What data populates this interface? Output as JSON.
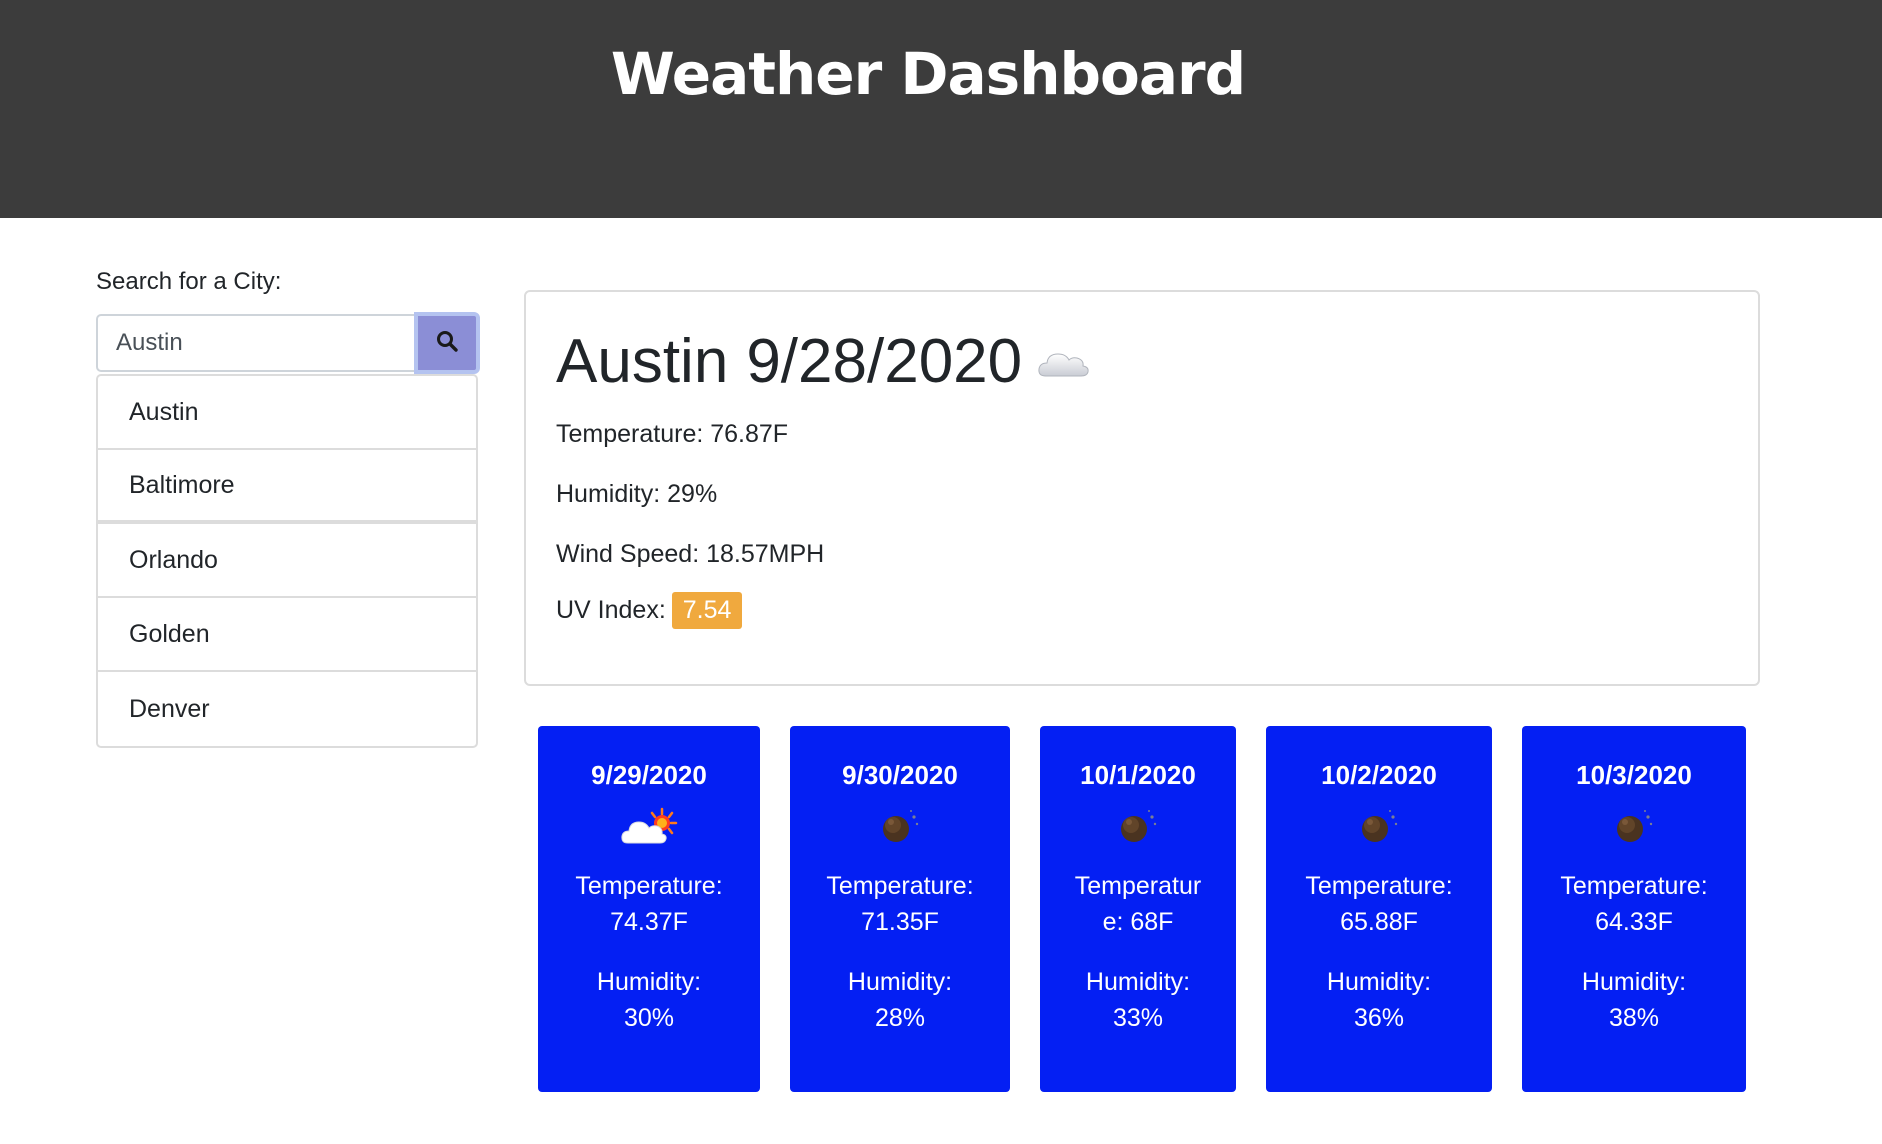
{
  "header": {
    "title": "Weather Dashboard"
  },
  "search": {
    "label": "Search for a City:",
    "value": "Austin",
    "button_icon": "search-icon"
  },
  "history": [
    "Austin",
    "Baltimore",
    "Orlando",
    "Golden",
    "Denver"
  ],
  "current": {
    "city": "Austin",
    "date": "9/28/2020",
    "icon": "cloud-icon",
    "temperature": "Temperature: 76.87F",
    "humidity": "Humidity: 29%",
    "wind": "Wind Speed: 18.57MPH",
    "uv_label": "UV Index:",
    "uv_value": "7.54",
    "uv_color": "#f0a93e"
  },
  "forecast": [
    {
      "date": "9/29/2020",
      "icon": "partly-cloudy-sun-icon",
      "temp_label": "Temperature:",
      "temp": "74.37F",
      "hum_label": "Humidity:",
      "hum": "30%"
    },
    {
      "date": "9/30/2020",
      "icon": "moon-icon",
      "temp_label": "Temperature:",
      "temp": "71.35F",
      "hum_label": "Humidity:",
      "hum": "28%"
    },
    {
      "date": "10/1/2020",
      "icon": "moon-icon",
      "temp_label": "Temperatur",
      "temp": "e: 68F",
      "hum_label": "Humidity:",
      "hum": "33%"
    },
    {
      "date": "10/2/2020",
      "icon": "moon-icon",
      "temp_label": "Temperature:",
      "temp": "65.88F",
      "hum_label": "Humidity:",
      "hum": "36%"
    },
    {
      "date": "10/3/2020",
      "icon": "moon-icon",
      "temp_label": "Temperature:",
      "temp": "64.33F",
      "hum_label": "Humidity:",
      "hum": "38%"
    }
  ],
  "colors": {
    "header_bg": "#3c3c3c",
    "forecast_bg": "#041ff3",
    "search_button": "#8b8ed6"
  }
}
